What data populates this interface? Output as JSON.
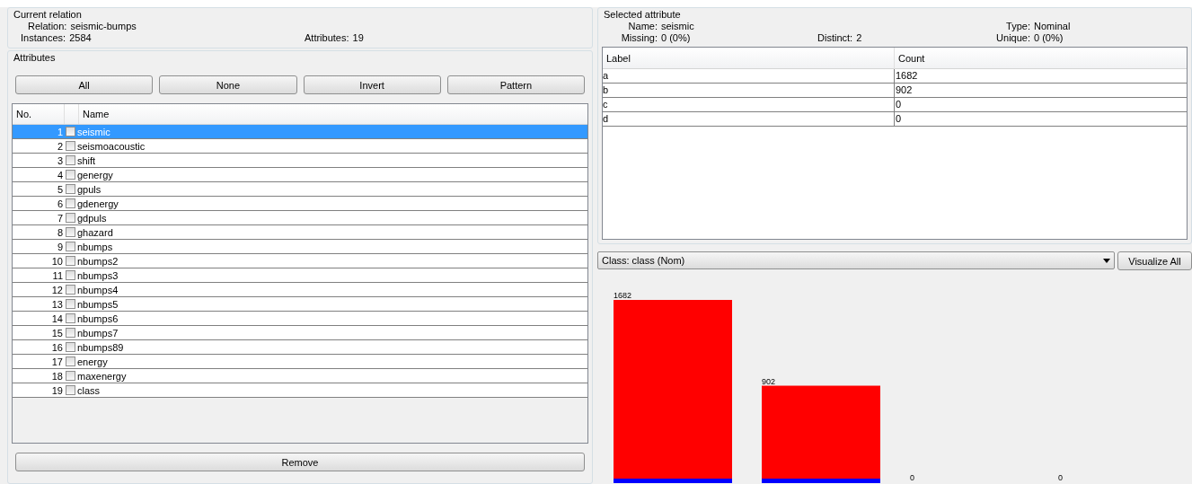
{
  "current_relation": {
    "title": "Current relation",
    "relation_label": "Relation:",
    "relation": "seismic-bumps",
    "instances_label": "Instances:",
    "instances": "2584",
    "attributes_label": "Attributes:",
    "attributes": "19"
  },
  "attributes": {
    "title": "Attributes",
    "buttons": [
      "All",
      "None",
      "Invert",
      "Pattern"
    ],
    "columns": [
      "No.",
      "Name"
    ],
    "rows": [
      {
        "no": "1",
        "name": "seismic",
        "checked": false,
        "selected": true
      },
      {
        "no": "2",
        "name": "seismoacoustic",
        "checked": false,
        "selected": false
      },
      {
        "no": "3",
        "name": "shift",
        "checked": false,
        "selected": false
      },
      {
        "no": "4",
        "name": "genergy",
        "checked": false,
        "selected": false
      },
      {
        "no": "5",
        "name": "gpuls",
        "checked": false,
        "selected": false
      },
      {
        "no": "6",
        "name": "gdenergy",
        "checked": false,
        "selected": false
      },
      {
        "no": "7",
        "name": "gdpuls",
        "checked": false,
        "selected": false
      },
      {
        "no": "8",
        "name": "ghazard",
        "checked": false,
        "selected": false
      },
      {
        "no": "9",
        "name": "nbumps",
        "checked": false,
        "selected": false
      },
      {
        "no": "10",
        "name": "nbumps2",
        "checked": false,
        "selected": false
      },
      {
        "no": "11",
        "name": "nbumps3",
        "checked": false,
        "selected": false
      },
      {
        "no": "12",
        "name": "nbumps4",
        "checked": false,
        "selected": false
      },
      {
        "no": "13",
        "name": "nbumps5",
        "checked": false,
        "selected": false
      },
      {
        "no": "14",
        "name": "nbumps6",
        "checked": false,
        "selected": false
      },
      {
        "no": "15",
        "name": "nbumps7",
        "checked": false,
        "selected": false
      },
      {
        "no": "16",
        "name": "nbumps89",
        "checked": false,
        "selected": false
      },
      {
        "no": "17",
        "name": "energy",
        "checked": false,
        "selected": false
      },
      {
        "no": "18",
        "name": "maxenergy",
        "checked": false,
        "selected": false
      },
      {
        "no": "19",
        "name": "class",
        "checked": false,
        "selected": false
      }
    ],
    "remove_button": "Remove"
  },
  "selected_attribute": {
    "title": "Selected attribute",
    "name": {
      "label": "Name:",
      "value": "seismic"
    },
    "type": {
      "label": "Type:",
      "value": "Nominal"
    },
    "missing": {
      "label": "Missing:",
      "value": "0 (0%)"
    },
    "distinct": {
      "label": "Distinct:",
      "value": "2"
    },
    "unique": {
      "label": "Unique:",
      "value": "0 (0%)"
    },
    "columns": [
      "Label",
      "Count"
    ],
    "rows": [
      [
        "a",
        "1682"
      ],
      [
        "b",
        "902"
      ],
      [
        "c",
        "0"
      ],
      [
        "d",
        "0"
      ]
    ]
  },
  "class_selector": {
    "value": "Class: class (Nom)",
    "visualize_button": "Visualize All"
  },
  "histogram": {
    "class_segments": [
      {
        "color": "#ff0000"
      },
      {
        "color": "#0000ff"
      }
    ],
    "bar_labels": [
      "1682",
      "902",
      "0",
      "0"
    ]
  }
}
